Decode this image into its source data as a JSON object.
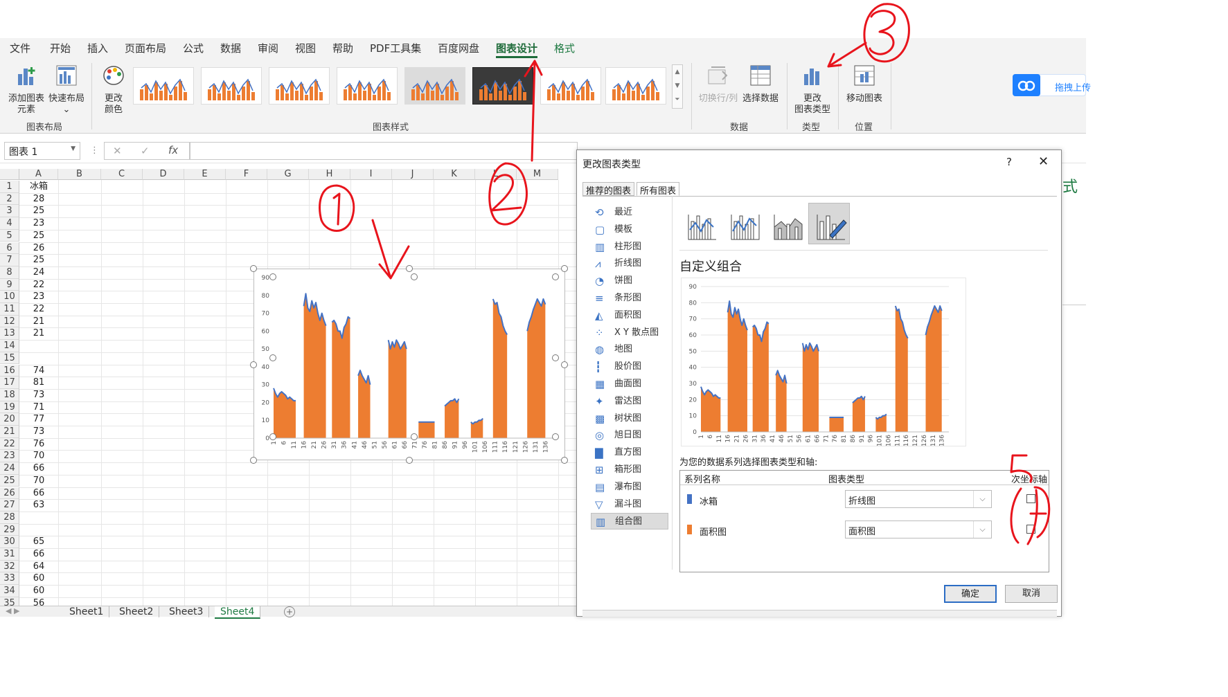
{
  "ribbon": {
    "tabs": [
      "文件",
      "开始",
      "插入",
      "页面布局",
      "公式",
      "数据",
      "审阅",
      "视图",
      "帮助",
      "PDF工具集",
      "百度网盘",
      "图表设计",
      "格式"
    ],
    "active_tab": "图表设计",
    "buttons": {
      "add_element": "添加图表",
      "add_element2": "元素",
      "quick_layout": "快速布局",
      "change_color": "更改",
      "change_color2": "颜色",
      "switch_rowcol": "切换行/列",
      "select_data": "选择数据",
      "change_type": "更改",
      "change_type2": "图表类型",
      "move_chart": "移动图表"
    },
    "groups": {
      "layout": "图表布局",
      "styles": "图表样式",
      "data": "数据",
      "type": "类型",
      "location": "位置"
    },
    "cloud_button": "拖拽上传"
  },
  "formula_bar": {
    "name_box": "图表 1",
    "cancel_symbol": "✕",
    "enter_symbol": "✓",
    "fx": "fx"
  },
  "sheet": {
    "columns": [
      "A",
      "B",
      "C",
      "D",
      "E",
      "F",
      "G",
      "H",
      "I",
      "J",
      "K",
      "L",
      "M"
    ],
    "rows": [
      {
        "n": "1",
        "a": "冰箱"
      },
      {
        "n": "2",
        "a": "28"
      },
      {
        "n": "3",
        "a": "25"
      },
      {
        "n": "4",
        "a": "23"
      },
      {
        "n": "5",
        "a": "25"
      },
      {
        "n": "6",
        "a": "26"
      },
      {
        "n": "7",
        "a": "25"
      },
      {
        "n": "8",
        "a": "24"
      },
      {
        "n": "9",
        "a": "22"
      },
      {
        "n": "10",
        "a": "23"
      },
      {
        "n": "11",
        "a": "22"
      },
      {
        "n": "12",
        "a": "21"
      },
      {
        "n": "13",
        "a": "21"
      },
      {
        "n": "14",
        "a": ""
      },
      {
        "n": "15",
        "a": ""
      },
      {
        "n": "16",
        "a": "74"
      },
      {
        "n": "17",
        "a": "81"
      },
      {
        "n": "18",
        "a": "73"
      },
      {
        "n": "19",
        "a": "71"
      },
      {
        "n": "20",
        "a": "77"
      },
      {
        "n": "21",
        "a": "73"
      },
      {
        "n": "22",
        "a": "76"
      },
      {
        "n": "23",
        "a": "70"
      },
      {
        "n": "24",
        "a": "66"
      },
      {
        "n": "25",
        "a": "70"
      },
      {
        "n": "26",
        "a": "66"
      },
      {
        "n": "27",
        "a": "63"
      },
      {
        "n": "28",
        "a": ""
      },
      {
        "n": "29",
        "a": ""
      },
      {
        "n": "30",
        "a": "65"
      },
      {
        "n": "31",
        "a": "66"
      },
      {
        "n": "32",
        "a": "64"
      },
      {
        "n": "33",
        "a": "60"
      },
      {
        "n": "34",
        "a": "60"
      },
      {
        "n": "35",
        "a": "56"
      }
    ],
    "tabs": [
      "Sheet1",
      "Sheet2",
      "Sheet3",
      "Sheet4"
    ],
    "active_tab": "Sheet4"
  },
  "chart_data": {
    "type": "area",
    "title": "",
    "ylim": [
      0,
      90
    ],
    "yticks": [
      "0",
      "10",
      "20",
      "30",
      "40",
      "50",
      "60",
      "70",
      "80",
      "90"
    ],
    "xticks": [
      "1",
      "6",
      "11",
      "16",
      "21",
      "26",
      "31",
      "36",
      "41",
      "46",
      "51",
      "56",
      "61",
      "66",
      "71",
      "76",
      "81",
      "86",
      "91",
      "96",
      "101",
      "106",
      "111",
      "116",
      "121",
      "126",
      "131",
      "136"
    ],
    "grid": false,
    "series": [
      {
        "name": "冰箱",
        "chart_type": "line",
        "color": "#4472C4"
      },
      {
        "name": "面积图",
        "chart_type": "area",
        "color": "#ED7D31"
      }
    ],
    "segments": [
      {
        "start": 1,
        "values": [
          28,
          25,
          23,
          25,
          26,
          25,
          24,
          22,
          23,
          22,
          21,
          21
        ]
      },
      {
        "start": 16,
        "values": [
          74,
          81,
          73,
          71,
          77,
          73,
          76,
          70,
          66,
          70,
          66,
          63
        ]
      },
      {
        "start": 30,
        "values": [
          65,
          66,
          64,
          60,
          60,
          56,
          62,
          64,
          68,
          67
        ]
      },
      {
        "start": 43,
        "values": [
          35,
          38,
          35,
          33,
          31,
          35,
          30
        ]
      },
      {
        "start": 58,
        "values": [
          55,
          50,
          54,
          51,
          55,
          53,
          50,
          52,
          54,
          50
        ]
      },
      {
        "start": 73,
        "values": [
          9,
          9,
          9,
          9,
          9,
          9,
          9,
          9,
          9
        ]
      },
      {
        "start": 86,
        "values": [
          18,
          19,
          20,
          21,
          21,
          22,
          20,
          22
        ]
      },
      {
        "start": 99,
        "values": [
          9,
          8,
          9,
          9,
          10,
          10,
          11
        ]
      },
      {
        "start": 110,
        "values": [
          78,
          75,
          76,
          70,
          68,
          63,
          60,
          58
        ]
      },
      {
        "start": 127,
        "values": [
          60,
          65,
          68,
          72,
          75,
          78,
          76,
          74,
          78,
          75
        ]
      }
    ]
  },
  "dialog": {
    "title": "更改图表类型",
    "help": "?",
    "close": "✕",
    "tabs": [
      "推荐的图表",
      "所有图表"
    ],
    "active_tab": "所有图表",
    "chart_types": [
      "最近",
      "模板",
      "柱形图",
      "折线图",
      "饼图",
      "条形图",
      "面积图",
      "X Y 散点图",
      "地图",
      "股价图",
      "曲面图",
      "雷达图",
      "树状图",
      "旭日图",
      "直方图",
      "箱形图",
      "瀑布图",
      "漏斗图",
      "组合图"
    ],
    "selected_type": "组合图",
    "combo_title": "自定义组合",
    "series_caption": "为您的数据系列选择图表类型和轴:",
    "table_headers": [
      "系列名称",
      "图表类型",
      "次坐标轴"
    ],
    "series_rows": [
      {
        "name": "冰箱",
        "type": "折线图",
        "color": "#4472C4",
        "secondary": false
      },
      {
        "name": "面积图",
        "type": "面积图",
        "color": "#ED7D31",
        "secondary": false
      }
    ],
    "ok": "确定",
    "cancel": "取消"
  },
  "right_strip": {
    "text": "式"
  }
}
